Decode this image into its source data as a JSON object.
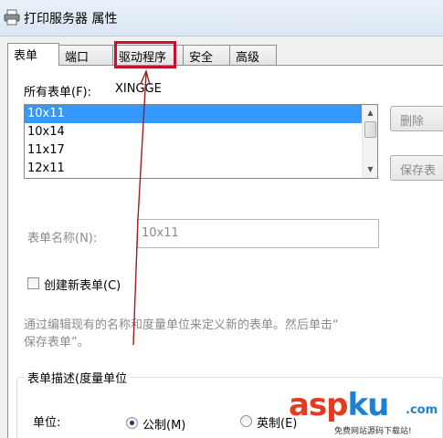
{
  "window": {
    "title": "打印服务器 属性"
  },
  "tabs": [
    {
      "label": "表单",
      "active": true
    },
    {
      "label": "端口",
      "active": false
    },
    {
      "label": "驱动程序",
      "active": false,
      "highlighted": true
    },
    {
      "label": "安全",
      "active": false
    },
    {
      "label": "高级",
      "active": false
    }
  ],
  "forms": {
    "label": "所有表单(F):",
    "server_name": "XINGGE",
    "items": [
      "10x11",
      "10x14",
      "11x17",
      "12x11"
    ],
    "selected": "10x11"
  },
  "buttons": {
    "delete": "删除",
    "save_form": "保存表"
  },
  "form_name": {
    "label": "表单名称(N):",
    "value": "10x11"
  },
  "create_new": {
    "label": "创建新表单(C)",
    "checked": false
  },
  "description": {
    "line1": "通过编辑现有的名称和度量单位来定义新的表单。然后单击“",
    "line2": "保存表单”。"
  },
  "group": {
    "title": "表单描述(度量单位",
    "unit_label": "单位:",
    "metric": {
      "label": "公制(M)",
      "selected": true
    },
    "imperial": {
      "label": "英制(E)",
      "selected": false
    }
  },
  "watermark": {
    "asp": "asp",
    "ku": "ku",
    "net": ".com",
    "tagline": "免费网站源码下载站!"
  },
  "colors": {
    "highlight_box": "#c8102e",
    "selection": "#3399ff",
    "arrow": "#a61b1b"
  }
}
